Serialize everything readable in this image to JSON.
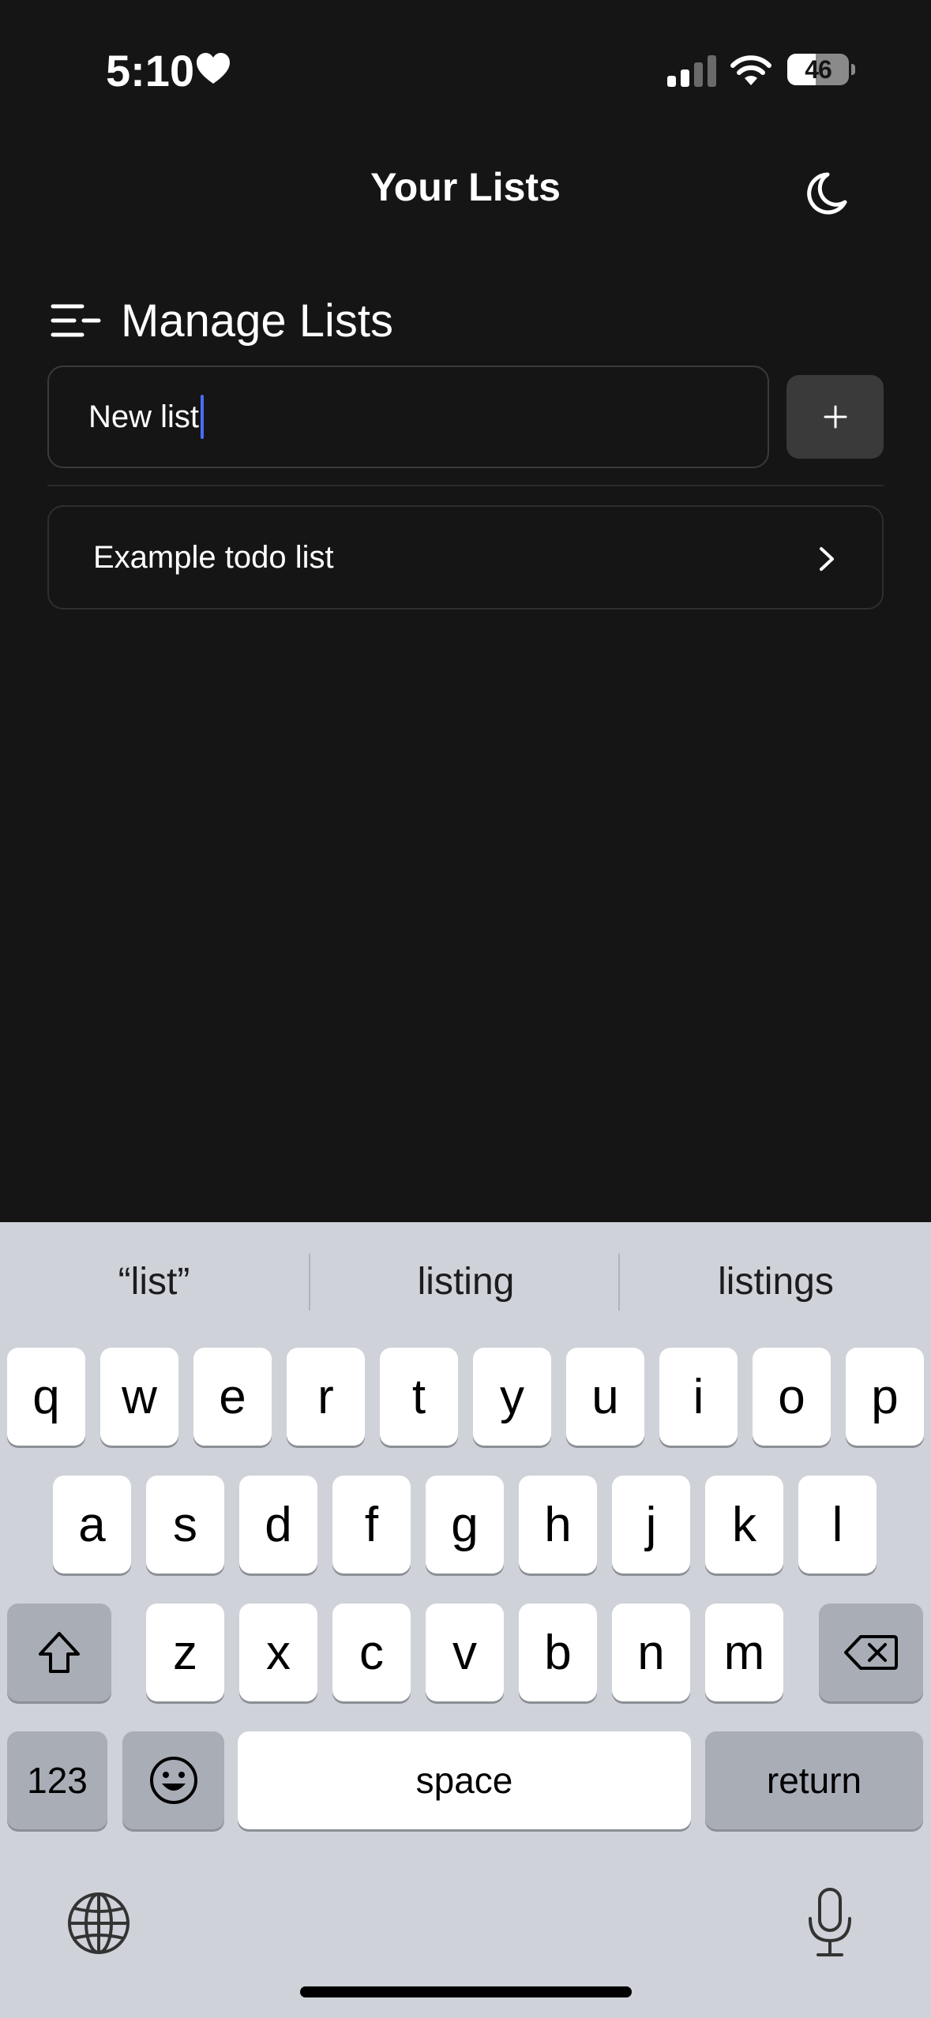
{
  "status_bar": {
    "time": "5:10",
    "battery_percent": 46,
    "battery_label": "46"
  },
  "header": {
    "title": "Your Lists"
  },
  "section": {
    "title": "Manage Lists"
  },
  "new_list": {
    "value": "New list",
    "add_label": "+"
  },
  "lists": [
    {
      "label": "Example todo list"
    }
  ],
  "keyboard": {
    "suggestions": [
      "“list”",
      "listing",
      "listings"
    ],
    "rows": [
      [
        "q",
        "w",
        "e",
        "r",
        "t",
        "y",
        "u",
        "i",
        "o",
        "p"
      ],
      [
        "a",
        "s",
        "d",
        "f",
        "g",
        "h",
        "j",
        "k",
        "l"
      ],
      [
        "z",
        "x",
        "c",
        "v",
        "b",
        "n",
        "m"
      ]
    ],
    "numbers_label": "123",
    "space_label": "space",
    "return_label": "return"
  },
  "colors": {
    "background": "#151515",
    "caret": "#4a6cf7",
    "keyboard_bg": "#cfd2d9"
  }
}
